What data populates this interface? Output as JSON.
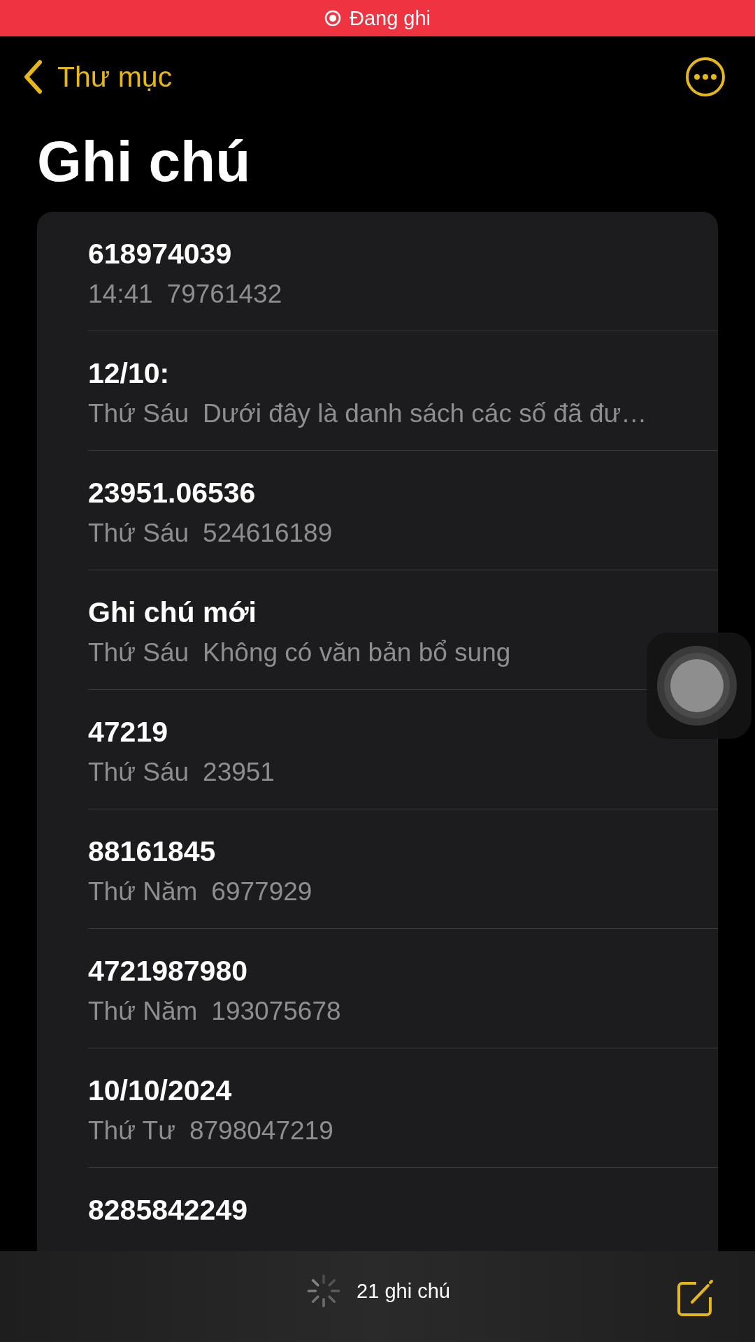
{
  "recording_banner": {
    "label": "Đang ghi"
  },
  "nav": {
    "back_label": "Thư mục"
  },
  "title": "Ghi chú",
  "notes": [
    {
      "title": "618974039",
      "date": "14:41",
      "preview": "79761432"
    },
    {
      "title": "12/10:",
      "date": "Thứ Sáu",
      "preview": "Dưới đây là danh sách các số đã đư…"
    },
    {
      "title": "23951.06536",
      "date": "Thứ Sáu",
      "preview": "524616189"
    },
    {
      "title": "Ghi chú mới",
      "date": "Thứ Sáu",
      "preview": "Không có văn bản bổ sung"
    },
    {
      "title": "47219",
      "date": "Thứ Sáu",
      "preview": "23951"
    },
    {
      "title": "88161845",
      "date": "Thứ Năm",
      "preview": "6977929"
    },
    {
      "title": "4721987980",
      "date": "Thứ Năm",
      "preview": "193075678"
    },
    {
      "title": "10/10/2024",
      "date": "Thứ Tư",
      "preview": "8798047219"
    },
    {
      "title": "8285842249"
    }
  ],
  "toolbar": {
    "count": "21 ghi chú"
  }
}
